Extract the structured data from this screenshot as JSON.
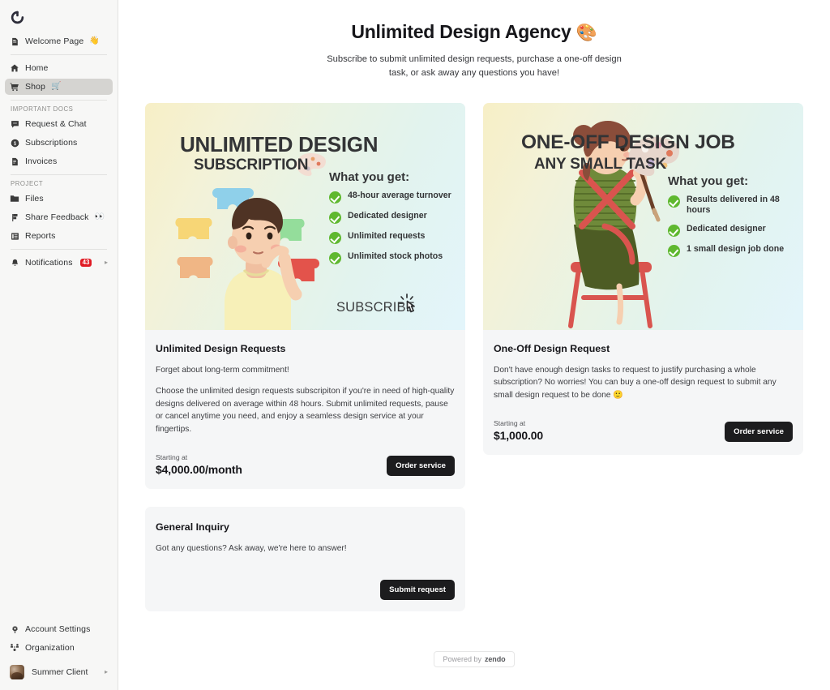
{
  "sidebar": {
    "logo": "spinner-logo",
    "top_items": [
      {
        "label": "Welcome Page",
        "icon": "document-icon",
        "emoji": "👋"
      }
    ],
    "nav_items": [
      {
        "label": "Home",
        "icon": "home-icon",
        "emoji": "",
        "active": false
      },
      {
        "label": "Shop",
        "icon": "cart-icon",
        "emoji": "🛒",
        "active": true
      }
    ],
    "groups": [
      {
        "title": "IMPORTANT DOCS",
        "items": [
          {
            "label": "Request & Chat",
            "icon": "chat-bubble-icon",
            "emoji": ""
          },
          {
            "label": "Subscriptions",
            "icon": "dollar-circle-icon",
            "emoji": ""
          },
          {
            "label": "Invoices",
            "icon": "invoice-icon",
            "emoji": ""
          }
        ]
      },
      {
        "title": "PROJECT",
        "items": [
          {
            "label": "Files",
            "icon": "folder-icon",
            "emoji": ""
          },
          {
            "label": "Share Feedback",
            "icon": "flag-icon",
            "emoji": "👀"
          },
          {
            "label": "Reports",
            "icon": "report-icon",
            "emoji": ""
          }
        ]
      }
    ],
    "notifications": {
      "label": "Notifications",
      "icon": "bell-icon",
      "badge": "43",
      "chevron": "▸"
    },
    "bottom_items": [
      {
        "label": "Account Settings",
        "icon": "gear-icon"
      },
      {
        "label": "Organization",
        "icon": "org-chart-icon"
      }
    ],
    "user": {
      "name": "Summer Client",
      "chevron": "▸"
    }
  },
  "header": {
    "title": "Unlimited Design Agency",
    "title_emoji": "🎨",
    "subtitle": "Subscribe to submit unlimited design requests, purchase a one-off design task, or ask away any questions you have!"
  },
  "cards": [
    {
      "hero": {
        "title_line1": "UNLIMITED DESIGN",
        "title_line2": "SUBSCRIPTION",
        "what_you_get": "What you get:",
        "benefits": [
          "48-hour average turnover",
          "Dedicated designer",
          "Unlimited requests",
          "Unlimited stock photos"
        ],
        "cta_word": "SUBSCRIBE"
      },
      "title": "Unlimited Design Requests",
      "paragraphs": [
        "Forget about long-term commitment!",
        "Choose the unlimited design requests subscripiton if you're in need of high-quality designs delivered on average within 48 hours. Submit unlimited requests, pause or cancel anytime you need, and enjoy a seamless design service at your fingertips."
      ],
      "starting_at_label": "Starting at",
      "price": "$4,000.00/month",
      "button_label": "Order service"
    },
    {
      "hero": {
        "title_line1": "ONE-OFF DESIGN JOB",
        "title_line2": "ANY SMALL TASK",
        "what_you_get": "What you get:",
        "benefits": [
          "Results delivered in 48 hours",
          "Dedicated designer",
          "1 small design job done"
        ],
        "cta_word": ""
      },
      "title": "One-Off Design Request",
      "paragraphs": [
        "Don't have enough design tasks to request to justify purchasing a whole subscription? No worries! You can buy a one-off design request to submit any small design request to be done 🙂"
      ],
      "starting_at_label": "Starting at",
      "price": "$1,000.00",
      "button_label": "Order service"
    }
  ],
  "inquiry": {
    "title": "General Inquiry",
    "text": "Got any questions? Ask away, we're here to answer!",
    "button_label": "Submit request"
  },
  "footer": {
    "prefix": "Powered by",
    "brand": "zendo"
  },
  "colors": {
    "accent_dark": "#1c1c1e",
    "badge_red": "#e01b24",
    "check_green": "#5fb82f",
    "sidebar_bg": "#f7f7f6",
    "card_bg": "#f5f6f7",
    "active_item_bg": "#d5d4d1"
  }
}
